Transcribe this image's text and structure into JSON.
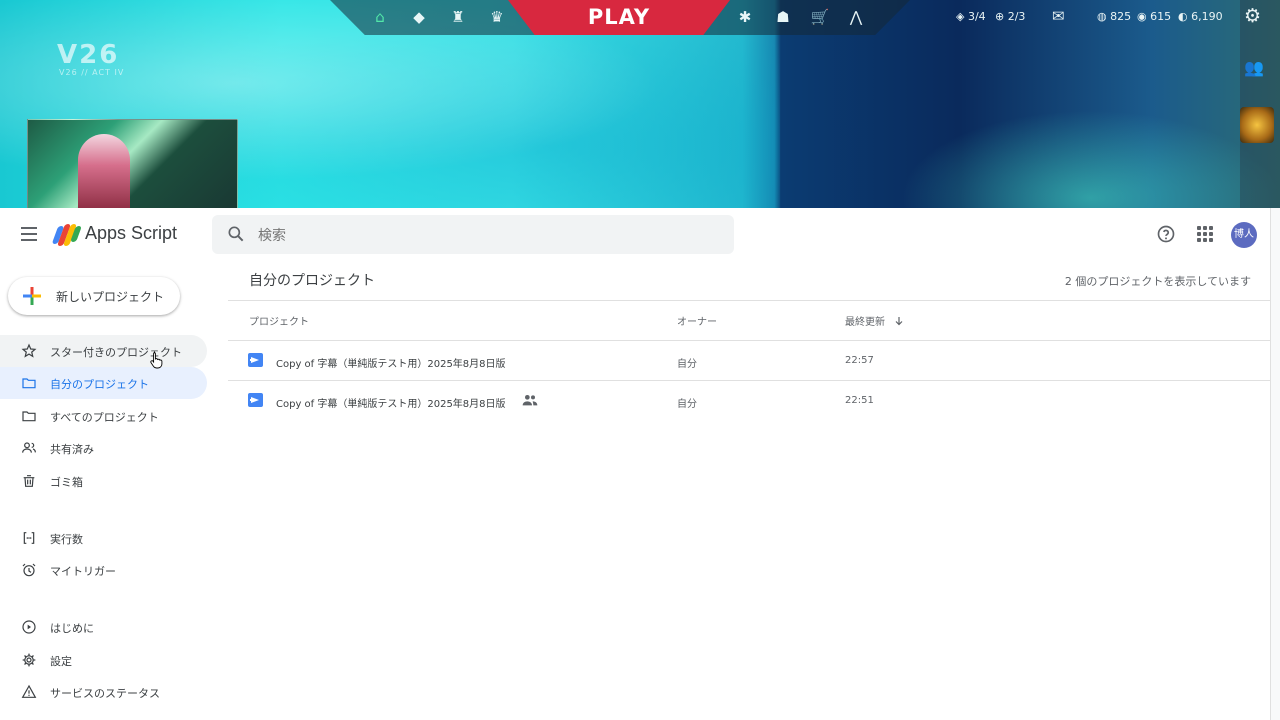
{
  "game": {
    "logo": "V26",
    "logo_sub": "V26 // ACT IV",
    "play_label": "PLAY",
    "level_progress": "3/4",
    "level_progress_2": "2/3",
    "currency_vp": "825",
    "currency_rp": "615",
    "currency_kc": "6,190",
    "nav_icons": [
      "home-icon",
      "agents-icon",
      "career-icon",
      "collection-icon",
      "battlepass-icon",
      "store-icon",
      "shop-icon",
      "rank-icon"
    ]
  },
  "app": {
    "brand": "Apps Script",
    "search_placeholder": "検索",
    "user_initials": "博人",
    "new_project_label": "新しいプロジェクト",
    "nav": [
      {
        "label": "スター付きのプロジェクト",
        "icon": "star-icon"
      },
      {
        "label": "自分のプロジェクト",
        "icon": "folder-icon"
      },
      {
        "label": "すべてのプロジェクト",
        "icon": "folder-icon"
      },
      {
        "label": "共有済み",
        "icon": "people-icon"
      },
      {
        "label": "ゴミ箱",
        "icon": "trash-icon"
      },
      {
        "label": "実行数",
        "icon": "executions-icon"
      },
      {
        "label": "マイトリガー",
        "icon": "alarm-icon"
      },
      {
        "label": "はじめに",
        "icon": "play-circle-icon"
      },
      {
        "label": "設定",
        "icon": "gear-icon"
      },
      {
        "label": "サービスのステータス",
        "icon": "warning-icon"
      }
    ],
    "main_title": "自分のプロジェクト",
    "project_count": "2 個のプロジェクトを表示しています",
    "columns": {
      "project": "プロジェクト",
      "owner": "オーナー",
      "updated": "最終更新",
      "sort_icon": "arrow-down-icon"
    },
    "projects": [
      {
        "name": "Copy of 字幕（単純版テスト用）2025年8月8日版",
        "owner": "自分",
        "updated": "22:57",
        "shared": false
      },
      {
        "name": "Copy of 字幕（単純版テスト用）2025年8月8日版",
        "owner": "自分",
        "updated": "22:51",
        "shared": true
      }
    ],
    "colors": {
      "accent": "#1a73e8",
      "active_bg": "#e8f0fe",
      "script_icon": "#4285f4",
      "play_red": "#d8283f"
    }
  }
}
